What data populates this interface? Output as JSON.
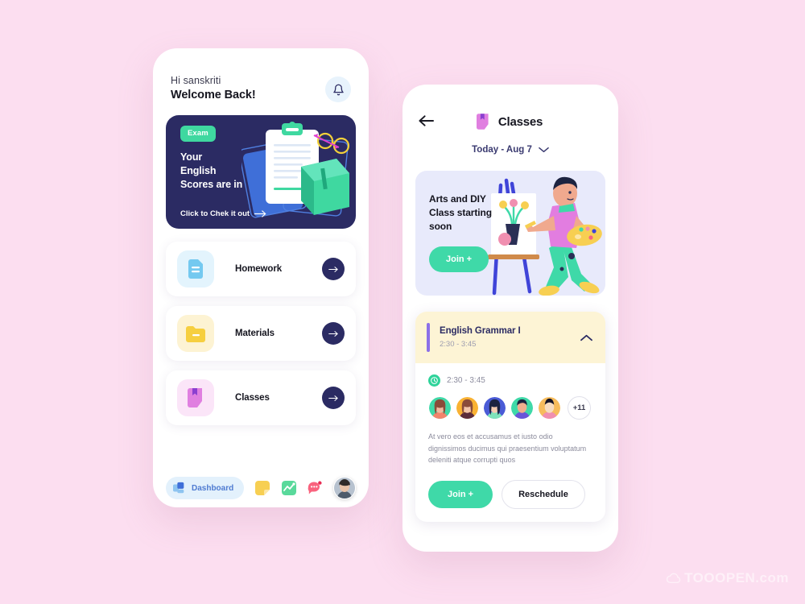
{
  "canvas": {
    "background_color": "#fcdef0",
    "watermark": "TOOOPEN.com"
  },
  "theme": {
    "navy": "#2b2b63",
    "mint": "#3fd9a8",
    "purple": "#8b6fe8",
    "yellow_card": "#fdf4d5",
    "lavender_card": "#e8eafb",
    "background": "#fcdef0"
  },
  "left_screen": {
    "greeting": {
      "hi": "Hi sanskriti",
      "welcome": "Welcome Back!"
    },
    "notification_icon": "bell-icon",
    "exam_banner": {
      "badge": "Exam",
      "title_line1": "Your",
      "title_line2": "English",
      "title_line3": "Scores are in",
      "cta": "Click to Chek it out",
      "cta_icon": "arrow-right-icon",
      "background_color": "#2b2b63",
      "badge_color": "#3fd8a0"
    },
    "menu": [
      {
        "label": "Homework",
        "icon": "document-icon",
        "tile_color": "#e3f4fd",
        "icon_color": "#74c9f0"
      },
      {
        "label": "Materials",
        "icon": "folder-icon",
        "tile_color": "#fdf3d3",
        "icon_color": "#f6cf3f"
      },
      {
        "label": "Classes",
        "icon": "bookmark-icon",
        "tile_color": "#fbe5f8",
        "icon_color": "#e07fe0"
      }
    ],
    "bottom_nav": {
      "active_label": "Dashboard",
      "active_icon": "dashboard-icon",
      "items": [
        {
          "icon": "notes-icon",
          "color": "#f7cf52"
        },
        {
          "icon": "chart-icon",
          "color": "#59d99b"
        },
        {
          "icon": "chat-icon",
          "color": "#f9637e"
        }
      ],
      "avatar": "user-avatar"
    }
  },
  "right_screen": {
    "header": {
      "back_icon": "arrow-left-icon",
      "title": "Classes",
      "title_icon": "bookmark-icon"
    },
    "date_selector": {
      "label": "Today - Aug 7",
      "icon": "chevron-down-icon"
    },
    "promo_card": {
      "title_line1": "Arts and DIY",
      "title_line2": "Class starting",
      "title_line3": "soon",
      "join_label": "Join +",
      "background_color": "#e8eafb",
      "illustration": "painter-easel-illustration"
    },
    "class_card": {
      "name": "English Grammar I",
      "time_header": "2:30 - 3:45",
      "collapse_icon": "chevron-up-icon",
      "accent_color": "#8b6fe8",
      "header_background": "#fdf4d5",
      "time_row": {
        "icon": "clock-icon",
        "text": "2:30 - 3:45"
      },
      "attendees": {
        "avatars": [
          {
            "name": "attendee-1",
            "bg": "#3fd9a8",
            "hair": "#8a4b3a",
            "skin": "#f2b9a0",
            "shirt": "#f2846c"
          },
          {
            "name": "attendee-2",
            "bg": "#f9b233",
            "hair": "#8a4b3a",
            "skin": "#f2c4aa",
            "shirt": "#5c2c3a"
          },
          {
            "name": "attendee-3",
            "bg": "#4a5bd6",
            "hair": "#1c2340",
            "skin": "#f4cbb0",
            "shirt": "#7fe3bb"
          },
          {
            "name": "attendee-4",
            "bg": "#3fd9a8",
            "hair": "#1c2340",
            "skin": "#f0ae8e",
            "shirt": "#6a55d8"
          },
          {
            "name": "attendee-5",
            "bg": "#f7bc5c",
            "hair": "#141428",
            "skin": "#f7dcc0",
            "shirt": "#f08fb0"
          }
        ],
        "more_count": "+11"
      },
      "description": "At vero eos et accusamus et iusto odio dignissimos ducimus qui praesentium voluptatum deleniti atque corrupti quos",
      "actions": {
        "join_label": "Join +",
        "reschedule_label": "Reschedule"
      }
    }
  }
}
